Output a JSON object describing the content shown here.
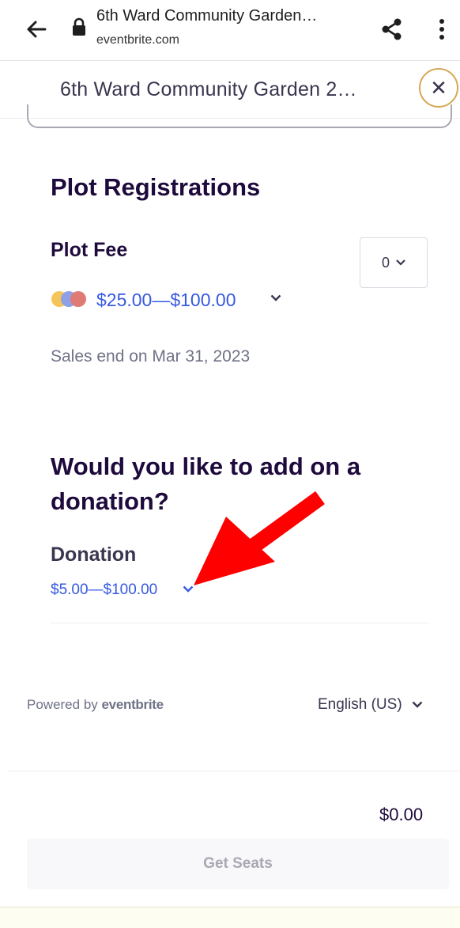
{
  "browser": {
    "title": "6th Ward Community Garden…",
    "domain": "eventbrite.com"
  },
  "modal": {
    "title": "6th Ward Community Garden 2…"
  },
  "plot_section": {
    "heading": "Plot Registrations",
    "ticket_name": "Plot Fee",
    "price_range": "$25.00—$100.00",
    "sales_end": "Sales end on Mar 31, 2023",
    "quantity": "0"
  },
  "donation_section": {
    "heading_line1": "Would you like to add on a",
    "heading_line2": "donation?",
    "ticket_name": "Donation",
    "price_range": "$5.00—$100.00"
  },
  "footer": {
    "powered_by": "Powered by",
    "brand": "eventbrite",
    "language": "English (US)"
  },
  "checkout": {
    "total": "$0.00",
    "button_label": "Get Seats"
  },
  "colors": {
    "accent_blue": "#3659e3",
    "heading_dark": "#1e0a3c",
    "close_ring": "#d6a855",
    "annotation_arrow": "#ff0000"
  },
  "icons": {
    "back": "arrow-left-icon",
    "lock": "lock-icon",
    "share": "share-icon",
    "menu": "more-vert-icon",
    "close": "close-icon",
    "chevron": "chevron-down-icon"
  }
}
